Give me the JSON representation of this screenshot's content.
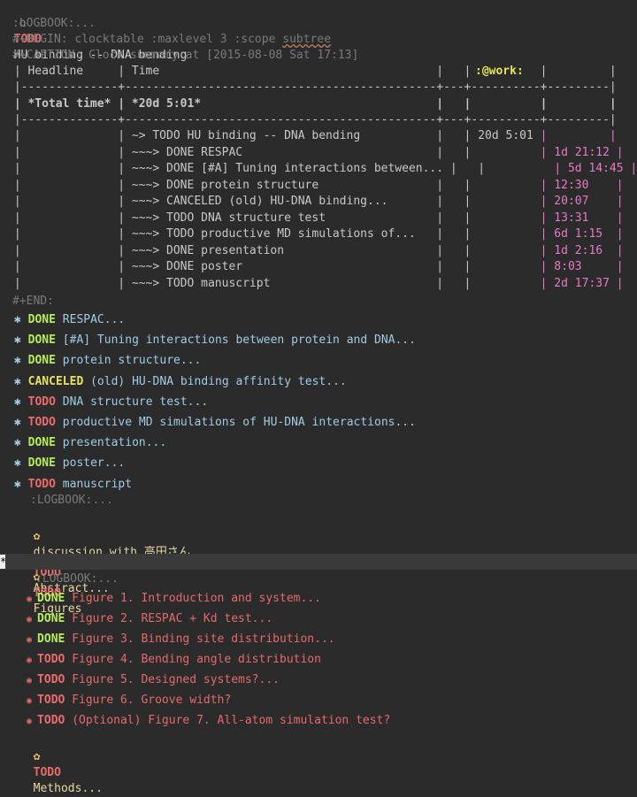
{
  "top": {
    "bullet": "o",
    "keyword": "TODO",
    "title": "HU binding -- DNA bending",
    "tag": ":@work:"
  },
  "logbook1": ":LOGBOOK:...",
  "begin": "#+BEGIN: clocktable :maxlevel 3 :scope ",
  "begin_arg": "subtree",
  "caption": "#+CAPTION: Clock summary at [2015-08-08 Sat 17:13]",
  "table": {
    "header": " | Headline     | Time                                        |   |          |         |",
    "rule1": " |--------------+---------------------------------------------+---+----------+---------|",
    "total": " | *Total time* | *20d 5:01*                                  |   |          |         |",
    "rule2": " |--------------+---------------------------------------------+---+----------+---------|",
    "rows": [
      {
        "pre": " |              | ~> TODO HU binding -- DNA bending           |   | 20d 5:01 ",
        "post": "|         |"
      },
      {
        "pre": " |              | ~~~> DONE RESPAC                            |   |          ",
        "post": "| 1d 21:12 |"
      },
      {
        "pre": " |              | ~~~> DONE [#A] Tuning interactions between... |   |          ",
        "post": "| 5d 14:45 |"
      },
      {
        "pre": " |              | ~~~> DONE protein structure                 |   |          ",
        "post": "| 12:30    |"
      },
      {
        "pre": " |              | ~~~> CANCELED (old) HU-DNA binding...       |   |          ",
        "post": "| 20:07    |"
      },
      {
        "pre": " |              | ~~~> TODO DNA structure test                |   |          ",
        "post": "| 13:31    |"
      },
      {
        "pre": " |              | ~~~> TODO productive MD simulations of...   |   |          ",
        "post": "| 6d 1:15  |"
      },
      {
        "pre": " |              | ~~~> DONE presentation                      |   |          ",
        "post": "| 1d 2:16  |"
      },
      {
        "pre": " |              | ~~~> DONE poster                            |   |          ",
        "post": "| 8:03     |"
      },
      {
        "pre": " |              | ~~~> TODO manuscript                        |   |          ",
        "post": "| 2d 17:37 |"
      }
    ]
  },
  "end": "#+END:",
  "l2": [
    {
      "kw": "DONE",
      "text": "RESPAC..."
    },
    {
      "kw": "DONE",
      "text": "[#A] Tuning interactions between protein and DNA..."
    },
    {
      "kw": "DONE",
      "text": "protein structure..."
    },
    {
      "kw": "CANCELED",
      "text": "(old) HU-DNA binding affinity test..."
    },
    {
      "kw": "TODO",
      "text": "DNA structure test..."
    },
    {
      "kw": "TODO",
      "text": "productive MD simulations of HU-DNA interactions..."
    },
    {
      "kw": "DONE",
      "text": "presentation..."
    },
    {
      "kw": "DONE",
      "text": "poster..."
    },
    {
      "kw": "TODO",
      "text": "manuscript"
    }
  ],
  "logbook2": ":LOGBOOK:...",
  "l3a": "discussion with 高田さん...",
  "l3b": {
    "kw": "TODO",
    "text": "Abstract..."
  },
  "l3c": {
    "kw": "TODO",
    "text": "Figures"
  },
  "logbook3": ":LOGBOOK:...",
  "l4": [
    {
      "kw": "DONE",
      "text": "Figure 1. Introduction and system..."
    },
    {
      "kw": "DONE",
      "text": "Figure 2. RESPAC + Kd test..."
    },
    {
      "kw": "DONE",
      "text": "Figure 3. Binding site distribution..."
    },
    {
      "kw": "TODO",
      "text": "Figure 4. Bending angle distribution"
    },
    {
      "kw": "TODO",
      "text": "Figure 5. Designed systems?..."
    },
    {
      "kw": "TODO",
      "text": "Figure 6. Groove width?"
    },
    {
      "kw": "TODO",
      "text": "(Optional) Figure 7. All-atom simulation test?"
    }
  ],
  "l3d": {
    "kw": "TODO",
    "text": "Methods..."
  },
  "cursor": "*",
  "icons": {
    "l2": "asterisk-bullet",
    "l3": "flower-bullet",
    "l4": "circle-bullet"
  }
}
